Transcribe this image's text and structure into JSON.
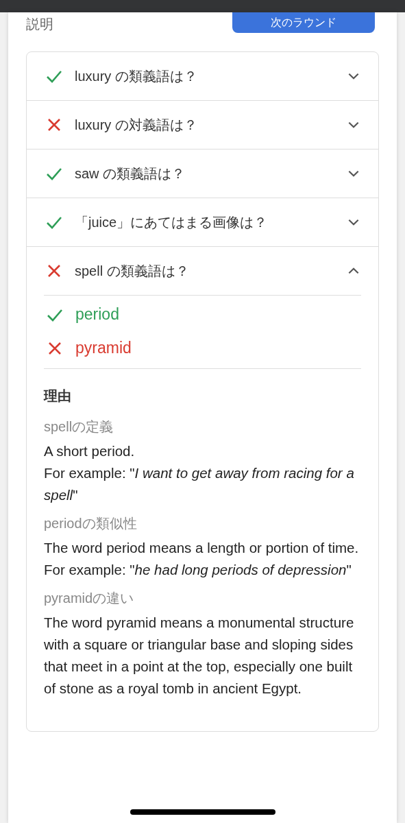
{
  "header": {
    "label": "説明",
    "button": "次のラウンド"
  },
  "questions": [
    {
      "text": "luxury の類義語は？",
      "correct": true,
      "expanded": false
    },
    {
      "text": "luxury の対義語は？",
      "correct": false,
      "expanded": false
    },
    {
      "text": "saw の類義語は？",
      "correct": true,
      "expanded": false
    },
    {
      "text": "「juice」にあてはまる画像は？",
      "correct": true,
      "expanded": false
    },
    {
      "text": "spell の類義語は？",
      "correct": false,
      "expanded": true,
      "answers": [
        {
          "text": "period",
          "correct": true
        },
        {
          "text": "pyramid",
          "correct": false
        }
      ],
      "reason": {
        "title": "理由",
        "sections": [
          {
            "heading": "spellの定義",
            "body": [
              "A short period.",
              "For example: \"*I want to get away from racing for a spell*\""
            ]
          },
          {
            "heading": "periodの類似性",
            "body": [
              "The word period means a length or portion of time.",
              "For example: \"*he had long periods of depression*\""
            ]
          },
          {
            "heading": "pyramidの違い",
            "body": [
              "The word pyramid means a monumental structure with a square or triangular base and sloping sides that meet in a point at the top, especially one built of stone as a royal tomb in ancient Egypt."
            ]
          }
        ]
      }
    }
  ]
}
